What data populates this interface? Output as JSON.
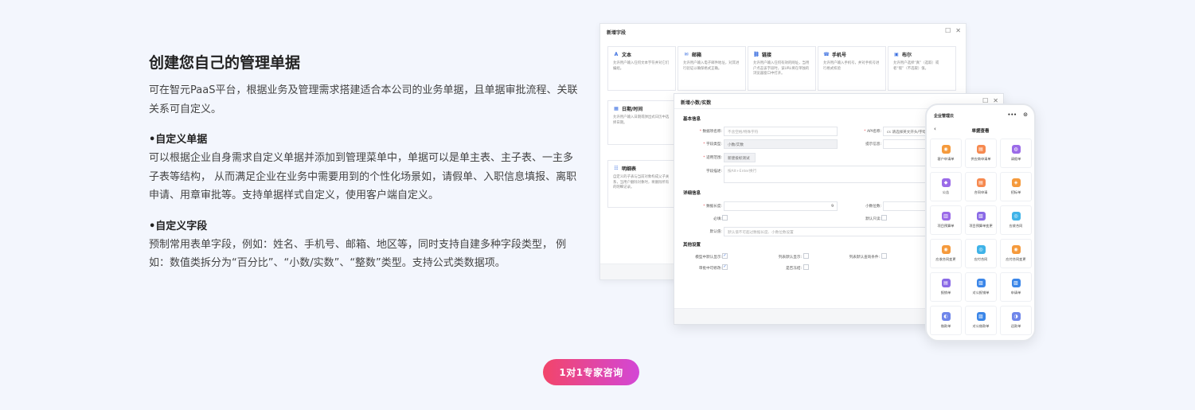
{
  "section": {
    "title": "创建您自己的管理单据",
    "intro": "可在智元PaaS平台，根据业务及管理需求搭建适合本公司的业务单据，且单据审批流程、关联关系可自定义。",
    "custom_doc_head": "•自定义单据",
    "custom_doc_body": "可以根据企业自身需求自定义单据并添加到管理菜单中，单据可以是单主表、主子表、一主多子表等结构， 从而满足企业在业务中需要用到的个性化场景如，请假单、入职信息填报、离职申请、用章审批等。支持单据样式自定义，使用客户端自定义。",
    "custom_field_head": "•自定义字段",
    "custom_field_body": "预制常用表单字段，例如：姓名、手机号、邮箱、地区等，同时支持自建多种字段类型， 例如：数值类拆分为“百分比”、“小数/实数”、“整数”类型。支持公式类数据项。"
  },
  "cta": {
    "label": "1对1专家咨询"
  },
  "window_new_field": {
    "title": "新增字段",
    "cards": [
      {
        "name": "文本",
        "icon": "text-icon",
        "glyph": "A",
        "desc": "允许用户输入任何文本字符并对它们编组。"
      },
      {
        "name": "邮箱",
        "icon": "mail-icon",
        "glyph": "✉",
        "desc": "允许用户输入电子邮件地址，对其进行验证以确保格式正确。"
      },
      {
        "name": "链接",
        "icon": "link-icon",
        "glyph": "⛓",
        "desc": "允许用户输入任何有效的网址，当用户点击该字段时，该URL将在单独的浏览器窗口中打开。"
      },
      {
        "name": "手机号",
        "icon": "phone-icon",
        "glyph": "☎",
        "desc": "允许用户输入手机号，并对手机号进行格式校验"
      },
      {
        "name": "布尔",
        "icon": "bool-icon",
        "glyph": "▣",
        "desc": "允许用户选择“真”（选取）或者“假”（不选取）值。"
      },
      {
        "name": "日期/时间",
        "icon": "calendar-icon",
        "glyph": "▦",
        "desc": "允许用户输入日期或弹出式日历中选择日期。"
      },
      {
        "name": "明细表",
        "icon": "table-icon",
        "glyph": "☷",
        "desc": "自定义的子表与当前对象构成父子关系，当用户删除对象时，将删除所有的明细记录。"
      }
    ]
  },
  "window_new_decimal": {
    "title": "新增小数/实数",
    "basic_section": "基本信息",
    "detail_section": "详细信息",
    "other_section": "其他设置",
    "fields": {
      "name_label": "数据项名称:",
      "name_placeholder": "不含空格/特殊字符",
      "api_label": "API名称:",
      "api_value": "cs 请选择英文开头/字母",
      "type_label": "字段类型:",
      "type_value": "小数/实数",
      "tip_label": "提示信息:",
      "scope_label": "适用范围:",
      "scope_value": "新建投标测试",
      "desc_label": "字段描述:",
      "desc_placeholder": "按Alt+Enter换行",
      "len_label": "数据长度:",
      "len_value": "9",
      "decimal_label": "小数位数:",
      "required_label": "必填:",
      "readonly_label": "默认只读:",
      "default_label": "默认值:",
      "default_placeholder": "默认值不可超过数据长度、小数位数设置",
      "opt1_label": "模型中默认显示:",
      "opt2_label": "列表默认显示:",
      "opt3_label": "列表默认查询条件:",
      "opt4_label": "审批中可修改:",
      "opt5_label": "是否冻结:"
    }
  },
  "phone": {
    "app_title": "企业管理云",
    "page_title": "单据查看",
    "more": "•••",
    "items": [
      {
        "label": "客户申请单",
        "color": "#f59a3c",
        "glyph": "◉"
      },
      {
        "label": "供应商申请单",
        "color": "#f6894f",
        "glyph": "▤"
      },
      {
        "label": "请假单",
        "color": "#9b6be8",
        "glyph": "◍"
      },
      {
        "label": "公告",
        "color": "#9b6be8",
        "glyph": "◆"
      },
      {
        "label": "合同申请",
        "color": "#f6894f",
        "glyph": "▤"
      },
      {
        "label": "招标单",
        "color": "#f59a3c",
        "glyph": "◈"
      },
      {
        "label": "项目预算单",
        "color": "#9b6be8",
        "glyph": "▥"
      },
      {
        "label": "项目预算单变更",
        "color": "#8a6ae6",
        "glyph": "▧"
      },
      {
        "label": "应收合同",
        "color": "#3fb3e8",
        "glyph": "◎"
      },
      {
        "label": "应收合同变更",
        "color": "#f59a3c",
        "glyph": "◉"
      },
      {
        "label": "应付合同",
        "color": "#3fb3e8",
        "glyph": "◎"
      },
      {
        "label": "应付合同变更",
        "color": "#f59a3c",
        "glyph": "◉"
      },
      {
        "label": "报销单",
        "color": "#8a6ae6",
        "glyph": "▤"
      },
      {
        "label": "对公报销单",
        "color": "#3b86e8",
        "glyph": "▨"
      },
      {
        "label": "申请单",
        "color": "#3b86e8",
        "glyph": "▨"
      },
      {
        "label": "借款单",
        "color": "#6f86ea",
        "glyph": "◐"
      },
      {
        "label": "对公借款单",
        "color": "#3b86e8",
        "glyph": "▨"
      },
      {
        "label": "还款单",
        "color": "#6f86ea",
        "glyph": "◑"
      }
    ]
  }
}
